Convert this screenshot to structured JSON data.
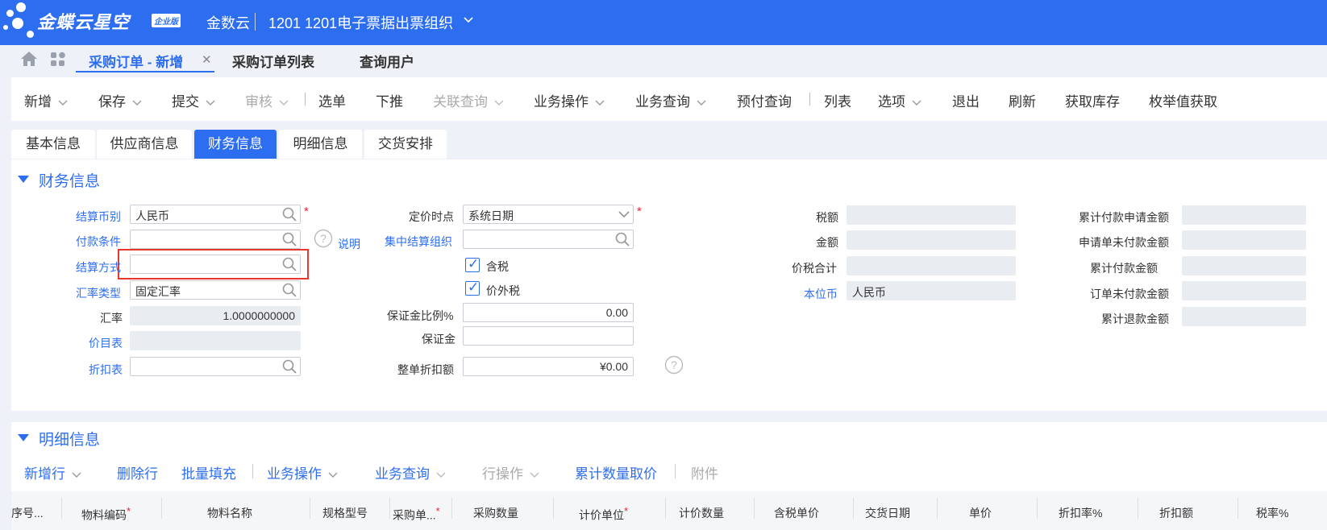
{
  "topbar": {
    "logo_text": "金蝶云星空",
    "logo_badge": "企业版",
    "org_name": "金数云",
    "org_unit": "1201 1201电子票据出票组织"
  },
  "tabs": [
    {
      "label": "采购订单 - 新增"
    },
    {
      "label": "采购订单列表"
    },
    {
      "label": "查询用户"
    }
  ],
  "toolbar": {
    "new": "新增",
    "save": "保存",
    "submit": "提交",
    "audit": "审核",
    "select_order": "选单",
    "push_down": "下推",
    "related_query": "关联查询",
    "biz_operation": "业务操作",
    "biz_query": "业务查询",
    "prepay_query": "预付查询",
    "list": "列表",
    "options": "选项",
    "exit": "退出",
    "refresh": "刷新",
    "get_stock": "获取库存",
    "enum_fetch": "枚举值获取"
  },
  "subtabs": [
    {
      "label": "基本信息"
    },
    {
      "label": "供应商信息"
    },
    {
      "label": "财务信息"
    },
    {
      "label": "明细信息"
    },
    {
      "label": "交货安排"
    }
  ],
  "finance": {
    "title": "财务信息",
    "settle_currency_label": "结算币别",
    "settle_currency_value": "人民币",
    "payment_terms_label": "付款条件",
    "payment_terms_value": "",
    "explain_label": "说明",
    "settle_method_label": "结算方式",
    "settle_method_value": "",
    "rate_type_label": "汇率类型",
    "rate_type_value": "固定汇率",
    "rate_label": "汇率",
    "rate_value": "1.0000000000",
    "price_list_label": "价目表",
    "price_list_value": "",
    "discount_list_label": "折扣表",
    "discount_list_value": "",
    "pricing_time_label": "定价时点",
    "pricing_time_value": "系统日期",
    "central_settle_org_label": "集中结算组织",
    "central_settle_org_value": "",
    "tax_included_label": "含税",
    "tax_excluded_label": "价外税",
    "deposit_ratio_label": "保证金比例%",
    "deposit_ratio_value": "0.00",
    "deposit_label": "保证金",
    "deposit_value": "",
    "whole_discount_label": "整单折扣额",
    "whole_discount_value": "¥0.00",
    "tax_amount_label": "税额",
    "amount_label": "金额",
    "total_with_tax_label": "价税合计",
    "local_currency_label": "本位币",
    "local_currency_value": "人民币",
    "acc_pay_request_label": "累计付款申请金额",
    "request_unpaid_label": "申请单未付款金额",
    "acc_paid_label": "累计付款金额",
    "order_unpaid_label": "订单未付款金额",
    "acc_refund_label": "累计退款金额"
  },
  "detail": {
    "title": "明细信息",
    "new_row": "新增行",
    "delete_row": "删除行",
    "batch_fill": "批量填充",
    "biz_operation": "业务操作",
    "biz_query": "业务查询",
    "row_operation": "行操作",
    "acc_qty_fetch": "累计数量取价",
    "attachment": "附件",
    "columns": [
      "序号...",
      "物料编码",
      "物料名称",
      "规格型号",
      "采购单...",
      "采购数量",
      "计价单位",
      "计价数量",
      "含税单价",
      "交货日期",
      "单价",
      "折扣率%",
      "折扣额",
      "税率%"
    ]
  },
  "colors": {
    "primary": "#2d6ef0",
    "highlight_box": "#e8372c",
    "required": "#e23"
  }
}
